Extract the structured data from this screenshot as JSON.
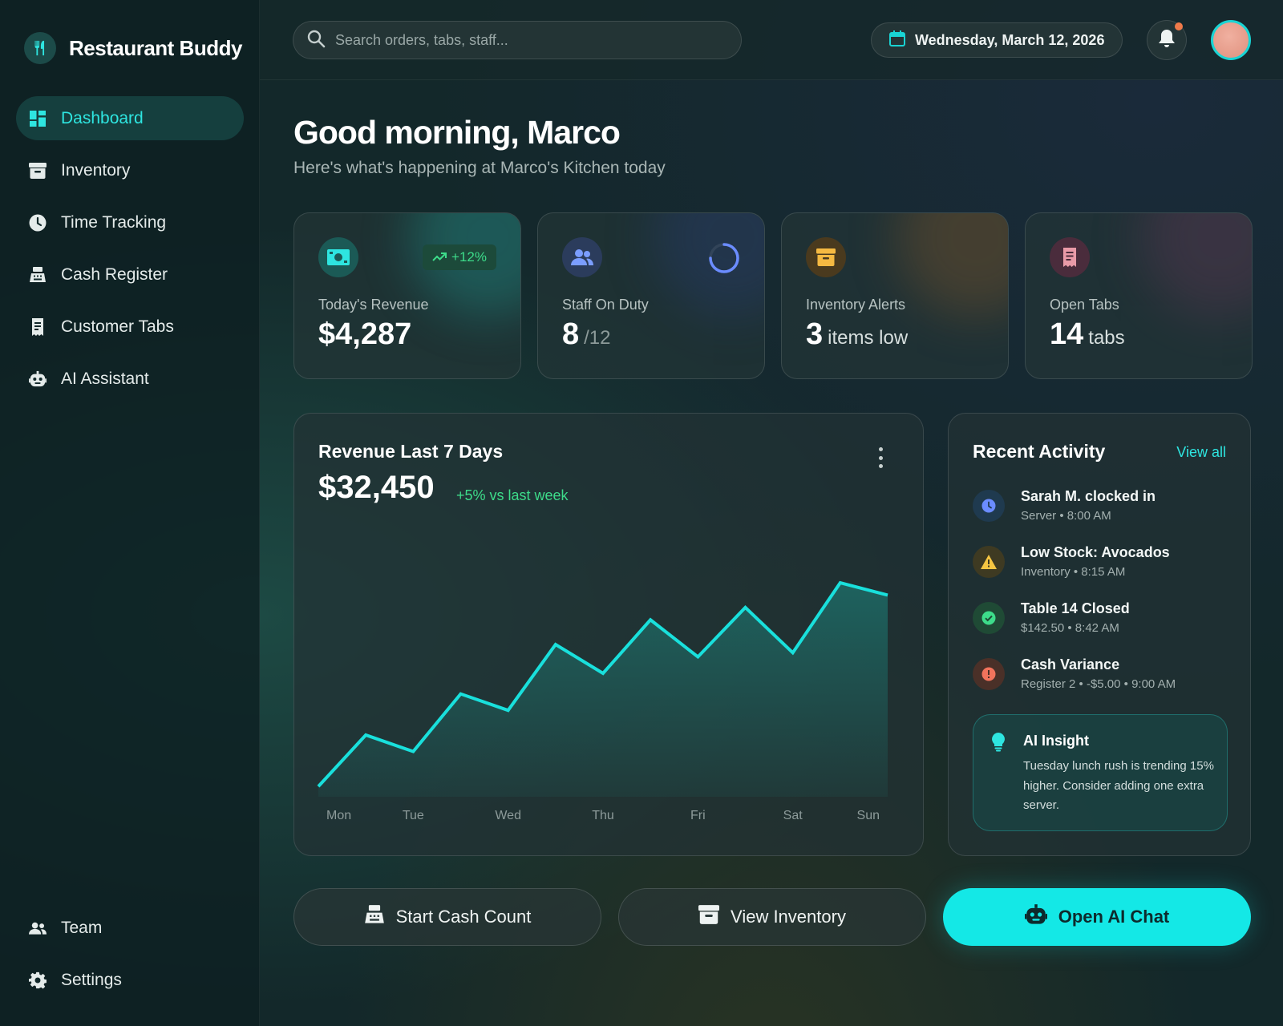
{
  "app": {
    "name": "Restaurant Buddy"
  },
  "sidebar": {
    "items": [
      {
        "label": "Dashboard",
        "icon": "dashboard-icon",
        "active": true
      },
      {
        "label": "Inventory",
        "icon": "archive-box-icon"
      },
      {
        "label": "Time Tracking",
        "icon": "clock-icon"
      },
      {
        "label": "Cash Register",
        "icon": "cash-register-icon"
      },
      {
        "label": "Customer Tabs",
        "icon": "receipt-icon"
      },
      {
        "label": "AI Assistant",
        "icon": "robot-icon"
      }
    ],
    "bottom_items": [
      {
        "label": "Team",
        "icon": "team-icon"
      },
      {
        "label": "Settings",
        "icon": "gear-icon"
      }
    ]
  },
  "header": {
    "search_placeholder": "Search orders, tabs, staff...",
    "date": "Wednesday, March 12, 2026"
  },
  "main": {
    "greeting": "Good morning, Marco",
    "subgreeting": "Here's what's happening at Marco's Kitchen today"
  },
  "stats": {
    "revenue": {
      "label": "Today's Revenue",
      "value": "$4,287",
      "trend": "+12%"
    },
    "staff": {
      "label": "Staff On Duty",
      "value": "8",
      "total": "/12"
    },
    "inventory": {
      "label": "Inventory Alerts",
      "value": "3",
      "unit": "items low"
    },
    "tabs": {
      "label": "Open Tabs",
      "value": "14",
      "unit": "tabs"
    }
  },
  "chart_card": {
    "title": "Revenue Last 7 Days",
    "total": "$32,450",
    "change": "+5% vs last week"
  },
  "chart_data": {
    "type": "area",
    "title": "Revenue Last 7 Days",
    "categories": [
      "Mon",
      "Tue",
      "Wed",
      "Thu",
      "Fri",
      "Sat",
      "Sun"
    ],
    "series": [
      {
        "values": [
          2.5,
          15,
          11,
          25,
          21,
          37,
          30,
          43,
          34,
          46,
          35,
          52,
          49
        ]
      }
    ],
    "x_positions": [
      0,
      0.5,
      1,
      1.5,
      2,
      2.5,
      3,
      3.5,
      4,
      4.5,
      5,
      5.5,
      6
    ],
    "ylim": [
      0,
      60
    ],
    "grid": false,
    "legend": "none",
    "colors": {
      "line": "#19e0dc",
      "fill": "#1e6b66"
    }
  },
  "activity": {
    "title": "Recent Activity",
    "view_all": "View all",
    "items": [
      {
        "title": "Sarah M. clocked in",
        "sub": "Server • 8:00 AM",
        "icon": "clock-icon",
        "color": "#6b8cff",
        "bg": "#1f3a4f"
      },
      {
        "title": "Low Stock: Avocados",
        "sub": "Inventory • 8:15 AM",
        "icon": "warning-icon",
        "color": "#f5c542",
        "bg": "#3e3a22"
      },
      {
        "title": "Table 14 Closed",
        "sub": "$142.50 • 8:42 AM",
        "icon": "check-circle-icon",
        "color": "#3ddc8a",
        "bg": "#1f4a35"
      },
      {
        "title": "Cash Variance",
        "sub": "Register 2 • -$5.00 • 9:00 AM",
        "icon": "alert-icon",
        "color": "#f2735c",
        "bg": "#4a3028"
      }
    ],
    "insight": {
      "title": "AI Insight",
      "text": "Tuesday lunch rush is trending 15% higher. Consider adding one extra server."
    }
  },
  "actions": {
    "cash_count": "Start Cash Count",
    "view_inventory": "View Inventory",
    "open_ai_chat": "Open AI Chat"
  },
  "colors": {
    "accent": "#14e8e6",
    "positive": "#3ddc8a",
    "background": "#13282a"
  }
}
